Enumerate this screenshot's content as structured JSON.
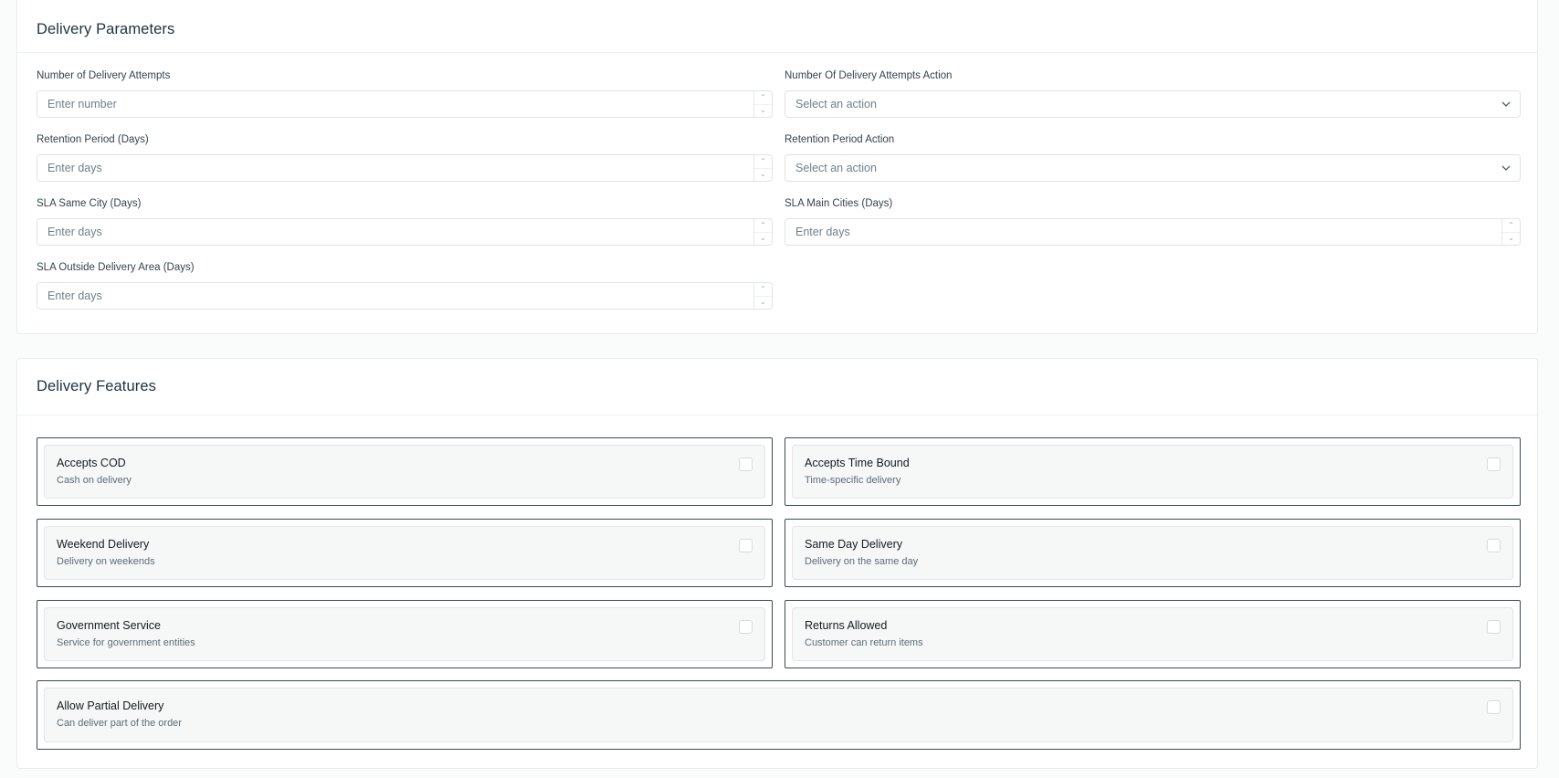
{
  "delivery_parameters": {
    "title": "Delivery Parameters",
    "fields": {
      "attempts": {
        "label": "Number of Delivery Attempts",
        "placeholder": "Enter number"
      },
      "attempts_action": {
        "label": "Number Of Delivery Attempts Action",
        "placeholder": "Select an action"
      },
      "retention": {
        "label": "Retention Period (Days)",
        "placeholder": "Enter days"
      },
      "retention_action": {
        "label": "Retention Period Action",
        "placeholder": "Select an action"
      },
      "sla_same_city": {
        "label": "SLA Same City (Days)",
        "placeholder": "Enter days"
      },
      "sla_main_cities": {
        "label": "SLA Main Cities (Days)",
        "placeholder": "Enter days"
      },
      "sla_outside": {
        "label": "SLA Outside Delivery Area (Days)",
        "placeholder": "Enter days"
      }
    }
  },
  "delivery_features": {
    "title": "Delivery Features",
    "items": [
      {
        "title": "Accepts COD",
        "description": "Cash on delivery",
        "checked": false
      },
      {
        "title": "Accepts Time Bound",
        "description": "Time-specific delivery",
        "checked": false
      },
      {
        "title": "Weekend Delivery",
        "description": "Delivery on weekends",
        "checked": false
      },
      {
        "title": "Same Day Delivery",
        "description": "Delivery on the same day",
        "checked": false
      },
      {
        "title": "Government Service",
        "description": "Service for government entities",
        "checked": false
      },
      {
        "title": "Returns Allowed",
        "description": "Customer can return items",
        "checked": false
      },
      {
        "title": "Allow Partial Delivery",
        "description": "Can deliver part of the order",
        "checked": false
      }
    ]
  },
  "icons": {
    "spinner_up": "chevron-up-icon",
    "spinner_down": "chevron-down-icon",
    "select_chevron": "chevron-down-icon"
  }
}
